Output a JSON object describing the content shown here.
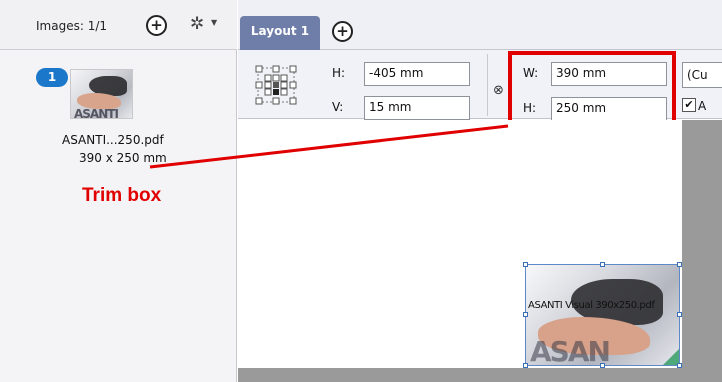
{
  "images_panel": {
    "count_label": "Images: 1/1",
    "add_glyph": "+",
    "gear_glyph": "✲",
    "caret_glyph": "▼",
    "image": {
      "badge": "1",
      "thumb_text": "ASANTI",
      "filename": "ASANTI...250.pdf",
      "size": "390 x 250 mm"
    }
  },
  "annotation": {
    "label": "Trim box",
    "color": "#e00000"
  },
  "tabs": {
    "active_tab": "Layout 1",
    "add_glyph": "+"
  },
  "toolbar": {
    "position": {
      "h_label": "H:",
      "h_value": "-405 mm",
      "v_label": "V:",
      "v_value": "15 mm"
    },
    "size": {
      "w_label": "W:",
      "w_value": "390 mm",
      "h_label": "H:",
      "h_value": "250 mm"
    },
    "link_glyph": "⊗",
    "dropdown_value": "(Cu",
    "checkbox_checked": true,
    "checkbox_glyph": "✔",
    "checkbox_label": "A"
  },
  "canvas": {
    "placed_caption": "ASANTI Visual 390x250.pdf",
    "placed_text": "ASAN"
  },
  "colors": {
    "badge": "#1a77c9",
    "tab": "#6f7ea8",
    "selection": "#3b6fb8"
  }
}
